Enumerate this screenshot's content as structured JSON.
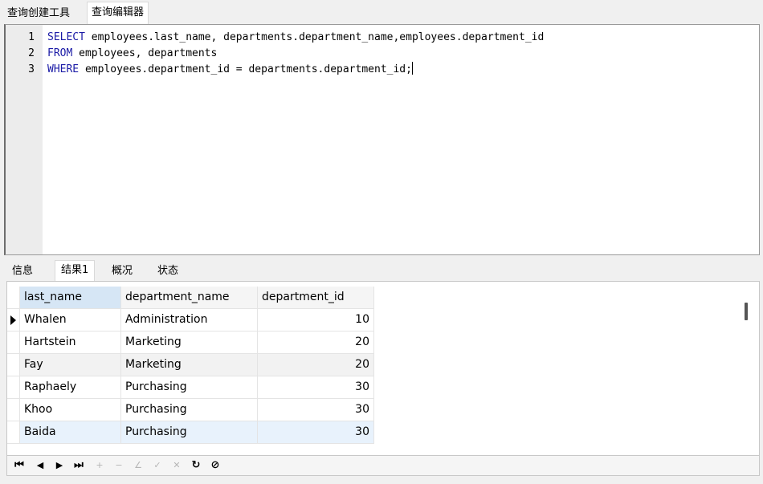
{
  "top_tabs": [
    "查询创建工具",
    "查询编辑器"
  ],
  "editor": {
    "line_numbers": [
      "1",
      "2",
      "3"
    ],
    "lines": [
      {
        "kw": "SELECT",
        "rest": " employees.last_name, departments.department_name,employees.department_id"
      },
      {
        "kw": "FROM",
        "rest": " employees, departments"
      },
      {
        "kw": "WHERE",
        "rest": " employees.department_id = departments.department_id;"
      }
    ]
  },
  "bottom_tabs": [
    "信息",
    "结果1",
    "概况",
    "状态"
  ],
  "results": {
    "columns": [
      "last_name",
      "department_name",
      "department_id"
    ],
    "rows": [
      [
        "Whalen",
        "Administration",
        "10"
      ],
      [
        "Hartstein",
        "Marketing",
        "20"
      ],
      [
        "Fay",
        "Marketing",
        "20"
      ],
      [
        "Raphaely",
        "Purchasing",
        "30"
      ],
      [
        "Khoo",
        "Purchasing",
        "30"
      ],
      [
        "Baida",
        "Purchasing",
        "30"
      ]
    ]
  },
  "navbar": {
    "first_icon": "⏮",
    "prev_icon": "◀",
    "next_icon": "▶",
    "last_icon": "⏭",
    "add_icon": "+",
    "delete_icon": "−",
    "edit_icon": "∠",
    "apply_icon": "✓",
    "discard_icon": "✕",
    "refresh_icon": "↻",
    "stop_icon": "⊘"
  }
}
